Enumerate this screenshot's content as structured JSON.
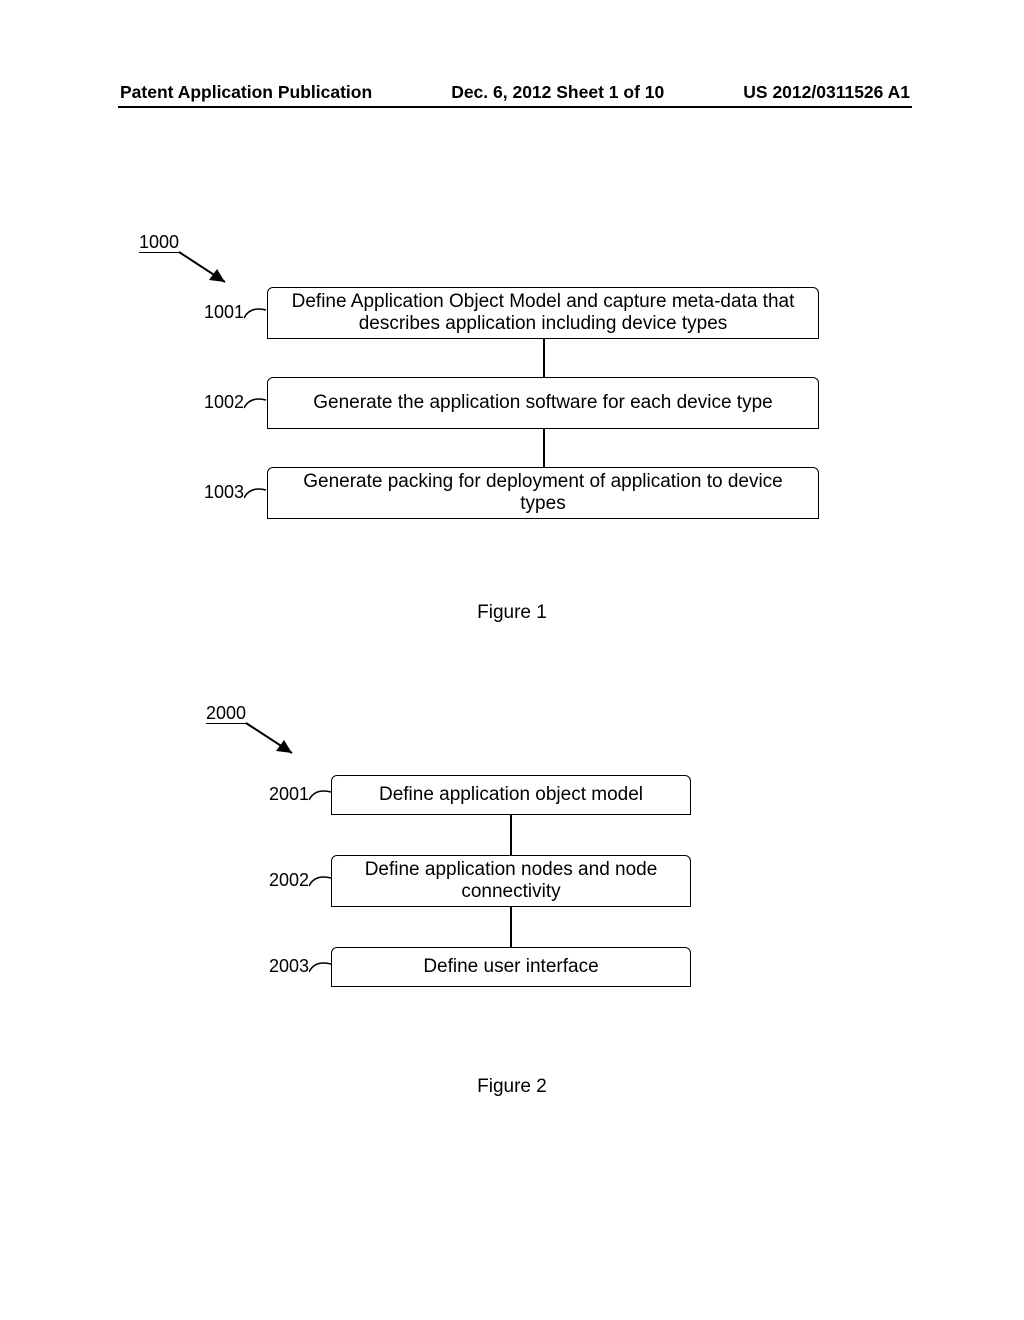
{
  "header": {
    "left": "Patent Application Publication",
    "center": "Dec. 6, 2012  Sheet 1 of 10",
    "right": "US 2012/0311526 A1"
  },
  "figure1": {
    "chart_ref": "1000",
    "steps": [
      {
        "ref": "1001",
        "text": "Define Application Object Model and capture meta-data that describes application including device types"
      },
      {
        "ref": "1002",
        "text": "Generate the application software for each device type"
      },
      {
        "ref": "1003",
        "text": "Generate packing for deployment of application to device types"
      }
    ],
    "caption": "Figure 1"
  },
  "figure2": {
    "chart_ref": "2000",
    "steps": [
      {
        "ref": "2001",
        "text": "Define application object model"
      },
      {
        "ref": "2002",
        "text": "Define application nodes and node connectivity"
      },
      {
        "ref": "2003",
        "text": "Define user interface"
      }
    ],
    "caption": "Figure 2"
  },
  "chart_data": [
    {
      "type": "flowchart",
      "id": "1000",
      "title": "Figure 1",
      "nodes": [
        {
          "id": "1001",
          "label": "Define Application Object Model and capture meta-data that describes application including device types"
        },
        {
          "id": "1002",
          "label": "Generate the application software for each device type"
        },
        {
          "id": "1003",
          "label": "Generate packing for deployment of application to device types"
        }
      ],
      "edges": [
        {
          "from": "1001",
          "to": "1002"
        },
        {
          "from": "1002",
          "to": "1003"
        }
      ]
    },
    {
      "type": "flowchart",
      "id": "2000",
      "title": "Figure 2",
      "nodes": [
        {
          "id": "2001",
          "label": "Define application object model"
        },
        {
          "id": "2002",
          "label": "Define application nodes and node connectivity"
        },
        {
          "id": "2003",
          "label": "Define user interface"
        }
      ],
      "edges": [
        {
          "from": "2001",
          "to": "2002"
        },
        {
          "from": "2002",
          "to": "2003"
        }
      ]
    }
  ]
}
